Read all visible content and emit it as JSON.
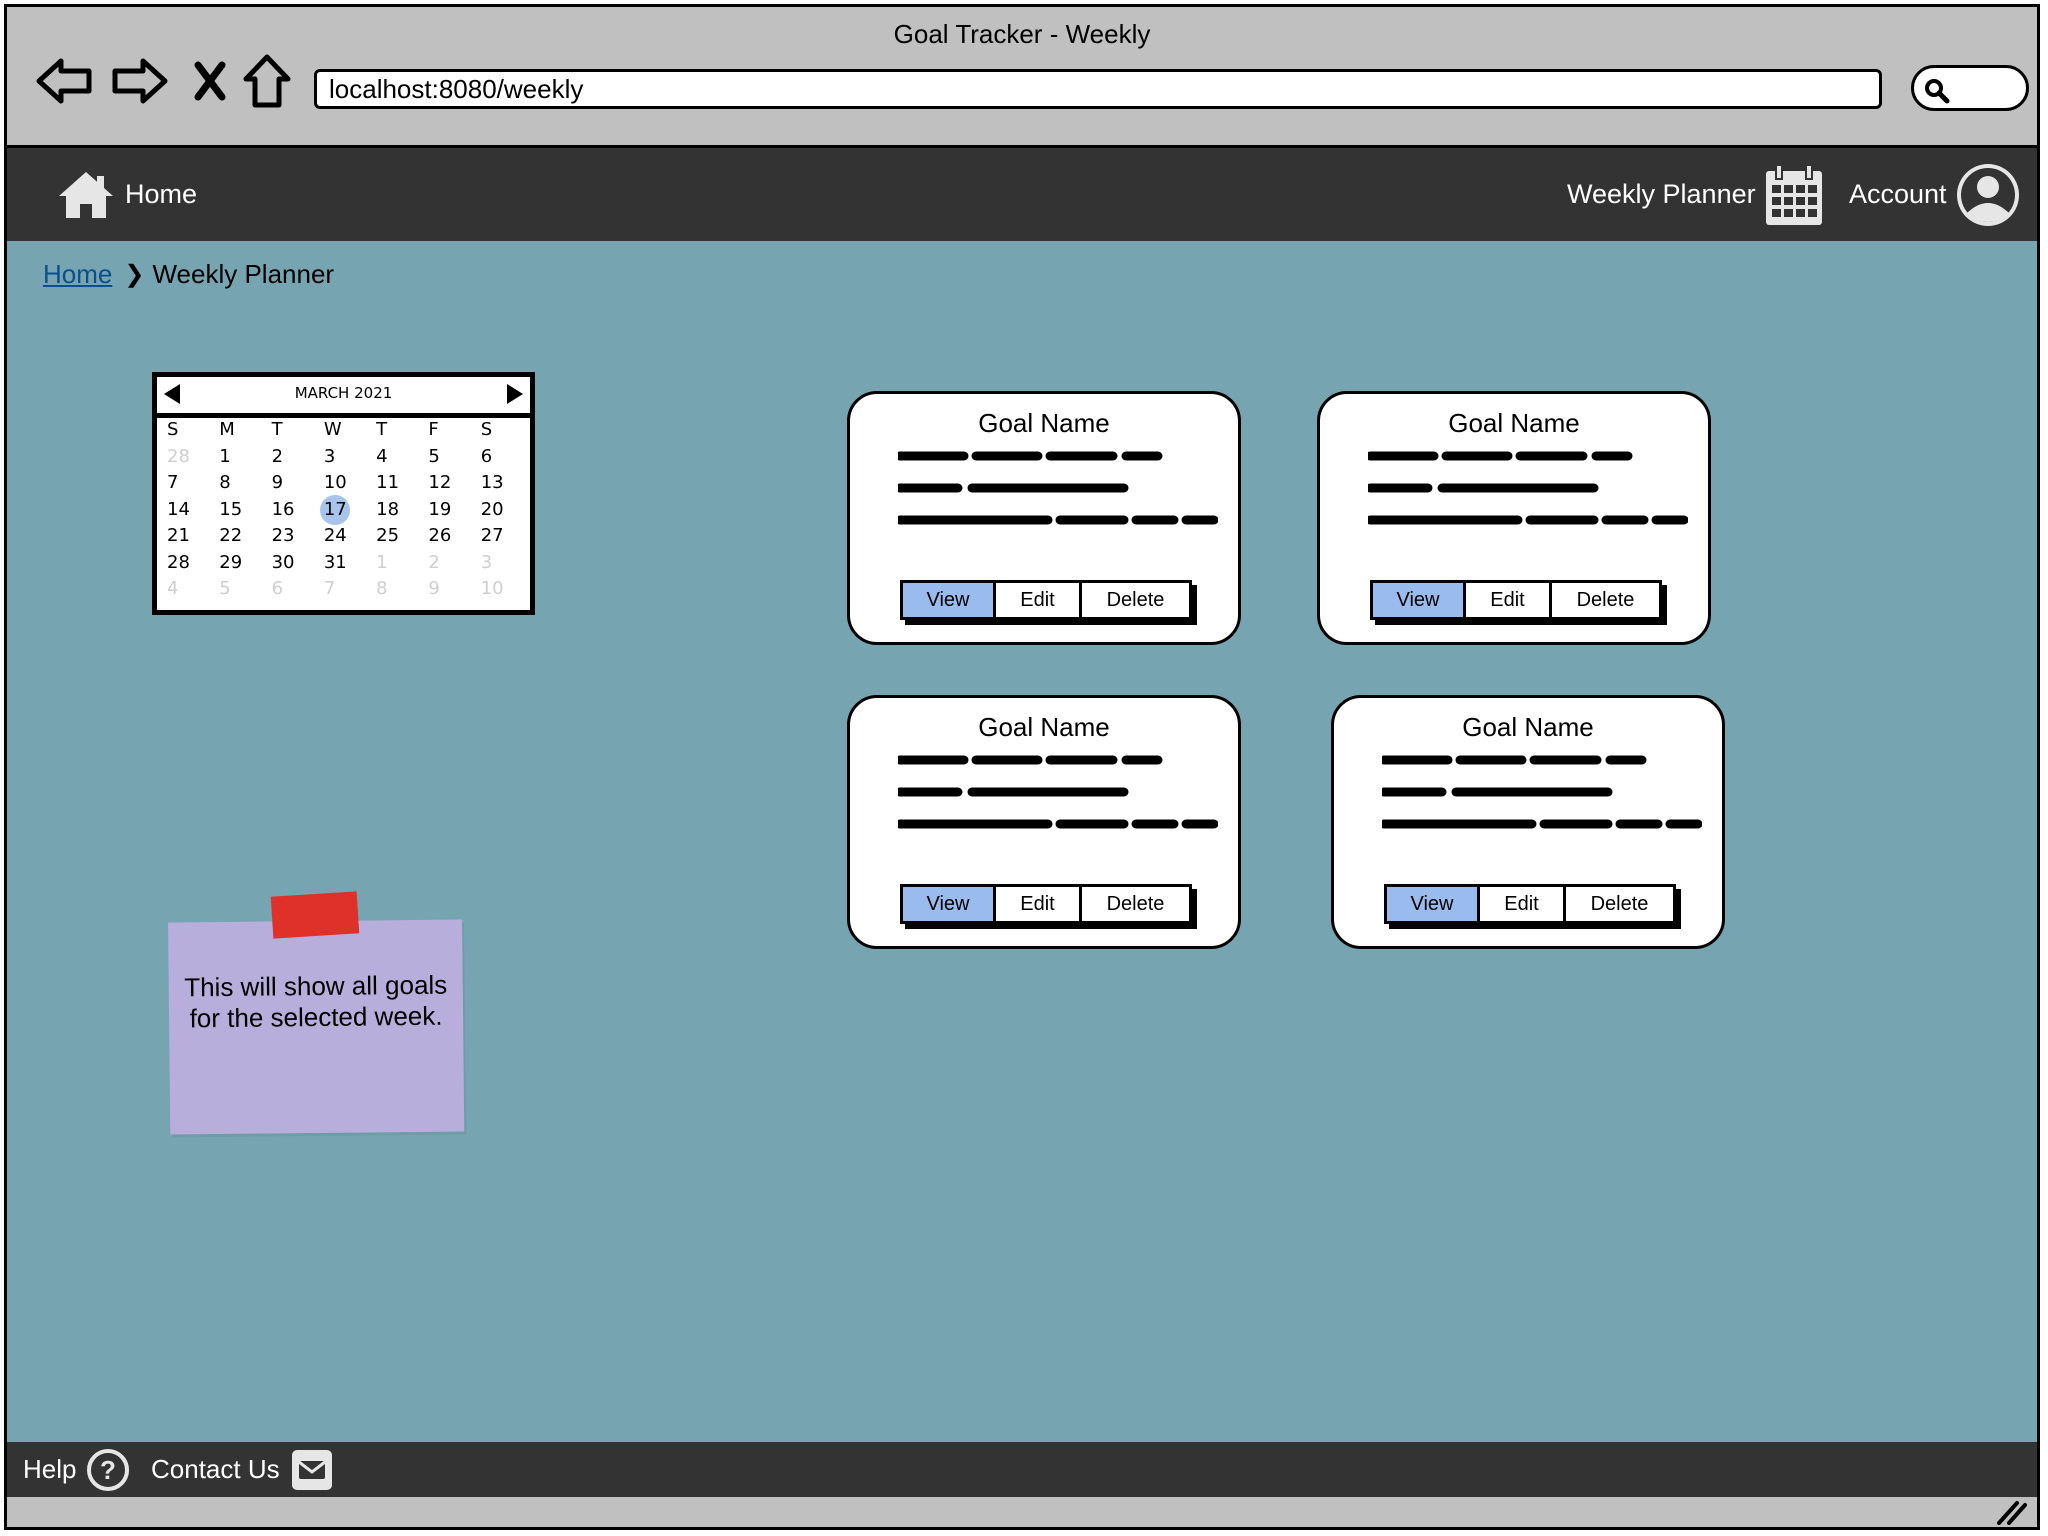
{
  "window": {
    "title": "Goal Tracker - Weekly"
  },
  "browser": {
    "url": "localhost:8080/weekly",
    "icons": [
      "back-arrow-icon",
      "forward-arrow-icon",
      "stop-icon",
      "home-icon",
      "search-icon"
    ]
  },
  "nav": {
    "home_label": "Home",
    "planner_label": "Weekly Planner",
    "account_label": "Account"
  },
  "breadcrumb": {
    "home": "Home",
    "current": "Weekly Planner"
  },
  "calendar": {
    "month_label": "MARCH 2021",
    "weekdays": [
      "S",
      "M",
      "T",
      "W",
      "T",
      "F",
      "S"
    ],
    "selected_day": "17",
    "weeks": [
      [
        {
          "d": "28",
          "dim": true
        },
        {
          "d": "1"
        },
        {
          "d": "2"
        },
        {
          "d": "3"
        },
        {
          "d": "4"
        },
        {
          "d": "5"
        },
        {
          "d": "6"
        }
      ],
      [
        {
          "d": "7"
        },
        {
          "d": "8"
        },
        {
          "d": "9"
        },
        {
          "d": "10"
        },
        {
          "d": "11"
        },
        {
          "d": "12"
        },
        {
          "d": "13"
        }
      ],
      [
        {
          "d": "14"
        },
        {
          "d": "15"
        },
        {
          "d": "16"
        },
        {
          "d": "17",
          "today": true
        },
        {
          "d": "18"
        },
        {
          "d": "19"
        },
        {
          "d": "20"
        }
      ],
      [
        {
          "d": "21"
        },
        {
          "d": "22"
        },
        {
          "d": "23"
        },
        {
          "d": "24"
        },
        {
          "d": "25"
        },
        {
          "d": "26"
        },
        {
          "d": "27"
        }
      ],
      [
        {
          "d": "28"
        },
        {
          "d": "29"
        },
        {
          "d": "30"
        },
        {
          "d": "31"
        },
        {
          "d": "1",
          "dim": true
        },
        {
          "d": "2",
          "dim": true
        },
        {
          "d": "3",
          "dim": true
        }
      ],
      [
        {
          "d": "4",
          "dim": true
        },
        {
          "d": "5",
          "dim": true
        },
        {
          "d": "6",
          "dim": true
        },
        {
          "d": "7",
          "dim": true
        },
        {
          "d": "8",
          "dim": true
        },
        {
          "d": "9",
          "dim": true
        },
        {
          "d": "10",
          "dim": true
        }
      ]
    ]
  },
  "note": {
    "text": "This will show all goals for the selected week."
  },
  "goals": [
    {
      "name": "Goal Name",
      "view": "View",
      "edit": "Edit",
      "delete": "Delete"
    },
    {
      "name": "Goal Name",
      "view": "View",
      "edit": "Edit",
      "delete": "Delete"
    },
    {
      "name": "Goal Name",
      "view": "View",
      "edit": "Edit",
      "delete": "Delete"
    },
    {
      "name": "Goal Name",
      "view": "View",
      "edit": "Edit",
      "delete": "Delete"
    }
  ],
  "footer": {
    "help_label": "Help",
    "contact_label": "Contact Us"
  },
  "colors": {
    "chrome": "#c0c0c0",
    "nav": "#333333",
    "canvas": "#76a5b1",
    "view_button": "#99bbee",
    "note": "#b8aedb",
    "note_tape": "#e0302a",
    "today_highlight": "#a9c4eb"
  }
}
